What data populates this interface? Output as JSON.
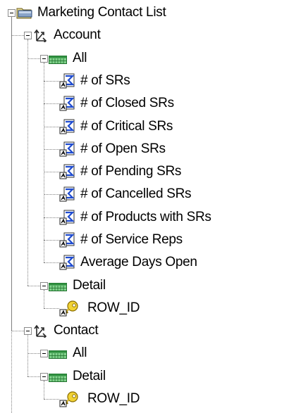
{
  "tree": {
    "root": {
      "label": "Marketing Contact List",
      "icon": "folder-icon",
      "children": [
        {
          "label": "Account",
          "icon": "dimension-icon",
          "children": [
            {
              "label": "All",
              "icon": "table-icon",
              "children": [
                {
                  "label": "# of SRs",
                  "icon": "metric-icon"
                },
                {
                  "label": "# of Closed SRs",
                  "icon": "metric-icon"
                },
                {
                  "label": "# of Critical SRs",
                  "icon": "metric-icon"
                },
                {
                  "label": "# of Open SRs",
                  "icon": "metric-icon"
                },
                {
                  "label": "# of Pending SRs",
                  "icon": "metric-icon"
                },
                {
                  "label": "# of Cancelled SRs",
                  "icon": "metric-icon"
                },
                {
                  "label": "# of Products with SRs",
                  "icon": "metric-icon"
                },
                {
                  "label": "# of Service Reps",
                  "icon": "metric-icon"
                },
                {
                  "label": "Average Days Open",
                  "icon": "metric-icon"
                }
              ]
            },
            {
              "label": "Detail",
              "icon": "table-icon",
              "children": [
                {
                  "label": "ROW_ID",
                  "icon": "key-icon"
                }
              ]
            }
          ]
        },
        {
          "label": "Contact",
          "icon": "dimension-icon",
          "children": [
            {
              "label": "All",
              "icon": "table-icon",
              "children": []
            },
            {
              "label": "Detail",
              "icon": "table-icon",
              "children": [
                {
                  "label": "ROW_ID",
                  "icon": "key-icon"
                }
              ]
            }
          ]
        }
      ]
    }
  }
}
